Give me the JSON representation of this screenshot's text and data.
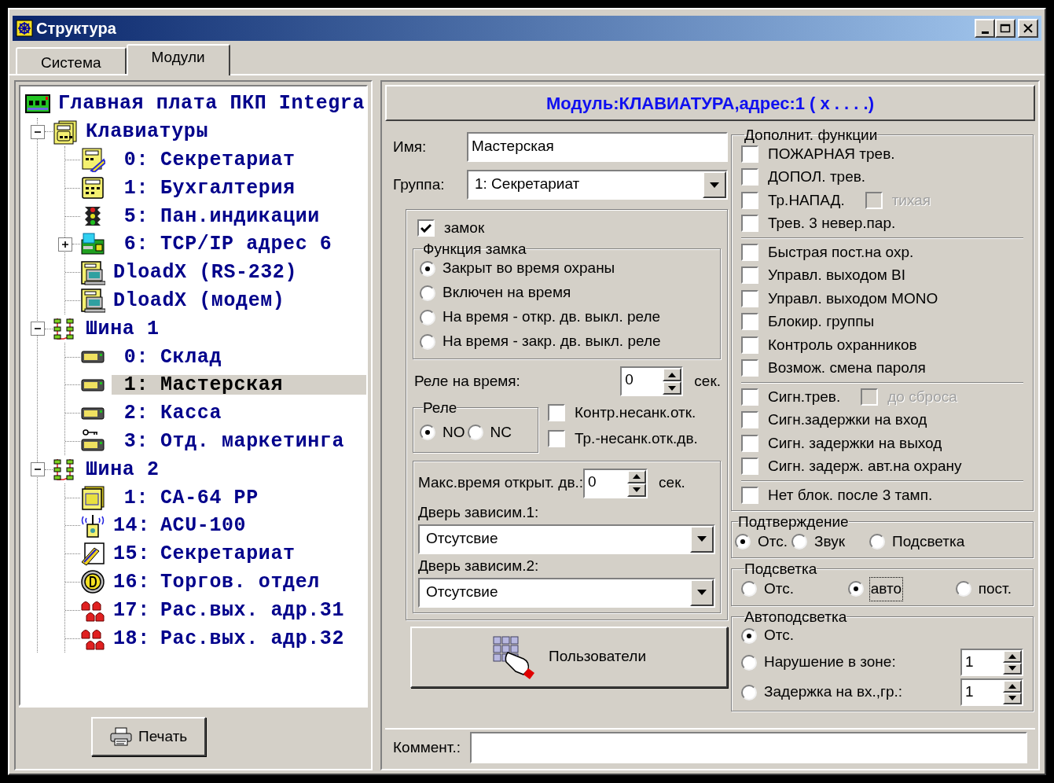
{
  "window": {
    "title": "Структура"
  },
  "tabs": [
    {
      "label": "Система",
      "selected": false
    },
    {
      "label": "Модули",
      "selected": true
    }
  ],
  "tree": {
    "items": [
      {
        "name": "Главная плата ПКП Integra",
        "kind": "main-board",
        "selected": false,
        "children": [
          {
            "name": "Клавиатуры",
            "kind": "keypad-group",
            "expanded": true,
            "selected": false,
            "children": [
              {
                "number": "0:",
                "name": "Секретариат",
                "kind": "keypad-card",
                "selected": false
              },
              {
                "number": "1:",
                "name": "Бухгалтерия",
                "kind": "keypad",
                "selected": false
              },
              {
                "number": "5:",
                "name": "Пан.индикации",
                "kind": "traffic-light",
                "selected": false
              },
              {
                "number": "6:",
                "name": "TCP/IP адрес 6",
                "kind": "ip-module",
                "expanded": false,
                "selected": false
              },
              {
                "name": "DloadX (RS-232)",
                "kind": "computer",
                "selected": false
              },
              {
                "name": "DloadX (модем)",
                "kind": "computer",
                "selected": false
              }
            ]
          },
          {
            "name": "Шина 1",
            "kind": "bus",
            "expanded": true,
            "selected": false,
            "children": [
              {
                "number": "0:",
                "name": "Склад",
                "kind": "wide-keypad",
                "selected": false
              },
              {
                "number": "1:",
                "name": "Мастерская",
                "kind": "wide-keypad",
                "selected": true
              },
              {
                "number": "2:",
                "name": "Касса",
                "kind": "wide-keypad",
                "selected": false
              },
              {
                "number": "3:",
                "name": "Отд. маркетинга",
                "kind": "key-keypad",
                "selected": false
              }
            ]
          },
          {
            "name": "Шина 2",
            "kind": "bus",
            "expanded": true,
            "selected": false,
            "children": [
              {
                "number": "1:",
                "name": "CA-64 PP",
                "kind": "expander",
                "selected": false
              },
              {
                "number": "14:",
                "name": "ACU-100",
                "kind": "wireless",
                "selected": false
              },
              {
                "number": "15:",
                "name": "Секретариат",
                "kind": "card-reader",
                "selected": false
              },
              {
                "number": "16:",
                "name": "Торгов. отдел",
                "kind": "round-reader",
                "selected": false
              },
              {
                "number": "17:",
                "name": "Рас.вых. адр.31",
                "kind": "sirens",
                "selected": false
              },
              {
                "number": "18:",
                "name": "Рас.вых. адр.32",
                "kind": "sirens",
                "selected": false
              }
            ]
          }
        ]
      }
    ]
  },
  "print_button": {
    "label": "Печать"
  },
  "module": {
    "header": "Модуль:КЛАВИАТУРА,адрес:1 ( x . . . .)",
    "name_field": {
      "label": "Имя:",
      "value": "Мастерская"
    },
    "group_field": {
      "label": "Группа:",
      "value": "1: Секретариат"
    },
    "lock": {
      "label": "замок",
      "checked": true,
      "function": {
        "title": "Функция замка",
        "options": [
          {
            "label": "Закрыт во время охраны",
            "selected": true
          },
          {
            "label": "Включен на время",
            "selected": false
          },
          {
            "label": "На время - откр. дв. выкл. реле",
            "selected": false
          },
          {
            "label": "На время - закр. дв. выкл. реле",
            "selected": false
          }
        ]
      },
      "relay_time": {
        "label": "Реле на время:",
        "value": "0",
        "unit": "сек."
      },
      "relay": {
        "title": "Реле",
        "options": [
          {
            "label": "NO",
            "selected": true
          },
          {
            "label": "NC",
            "selected": false
          }
        ]
      },
      "checks": [
        {
          "label": "Контр.несанк.отк.",
          "checked": false
        },
        {
          "label": "Тр.-несанк.отк.дв.",
          "checked": false
        }
      ],
      "max_open": {
        "label": "Макс.время открыт. дв.:",
        "value": "0",
        "unit": "сек."
      },
      "dependent": [
        {
          "label": "Дверь зависим.1:",
          "value": "Отсутсвие"
        },
        {
          "label": "Дверь зависим.2:",
          "value": "Отсутсвие"
        }
      ]
    },
    "users_button": {
      "label": "Пользователи"
    },
    "extra_functions": {
      "title": "Дополнит. функции",
      "groups": [
        [
          {
            "label": "ПОЖАРНАЯ трев.",
            "checked": false
          },
          {
            "label": "ДОПОЛ. трев.",
            "checked": false
          },
          {
            "label": "Тр.НАПАД.",
            "checked": false,
            "sub": {
              "label": "тихая",
              "checked": false,
              "disabled": true
            }
          },
          {
            "label": "Трев. 3 невер.пар.",
            "checked": false
          }
        ],
        [
          {
            "label": "Быстрая пост.на охр.",
            "checked": false
          },
          {
            "label": "Управл. выходом BI",
            "checked": false
          },
          {
            "label": "Управл. выходом MONO",
            "checked": false
          },
          {
            "label": "Блокир. группы",
            "checked": false
          },
          {
            "label": "Контроль охранников",
            "checked": false
          },
          {
            "label": "Возмож. смена пароля",
            "checked": false
          }
        ],
        [
          {
            "label": "Сигн.трев.",
            "checked": false,
            "sub": {
              "label": "до сброса",
              "checked": false,
              "disabled": true
            }
          },
          {
            "label": "Сигн.задержки на вход",
            "checked": false
          },
          {
            "label": "Сигн. задержки на выход",
            "checked": false
          },
          {
            "label": "Сигн. задерж. авт.на охрану",
            "checked": false
          }
        ],
        [
          {
            "label": "Нет блок. после 3 тамп.",
            "checked": false
          }
        ]
      ]
    },
    "confirmation": {
      "title": "Подтверждение",
      "options": [
        {
          "label": "Отс.",
          "selected": true,
          "focused": false
        },
        {
          "label": "Звук",
          "selected": false,
          "focused": false
        },
        {
          "label": "Подсветка",
          "selected": false,
          "focused": false
        }
      ]
    },
    "backlight": {
      "title": "Подсветка",
      "options": [
        {
          "label": "Отс.",
          "selected": false,
          "focused": false
        },
        {
          "label": "авто",
          "selected": true,
          "focused": true
        },
        {
          "label": "пост.",
          "selected": false,
          "focused": false
        }
      ]
    },
    "auto_backlight": {
      "title": "Автоподсветка",
      "options": [
        {
          "label": "Отс.",
          "selected": true
        },
        {
          "label": "Нарушение в зоне:",
          "selected": false,
          "value": "1"
        },
        {
          "label": "Задержка на вх.,гр.:",
          "selected": false,
          "value": "1"
        }
      ]
    },
    "comment": {
      "label": "Коммент.:"
    }
  }
}
